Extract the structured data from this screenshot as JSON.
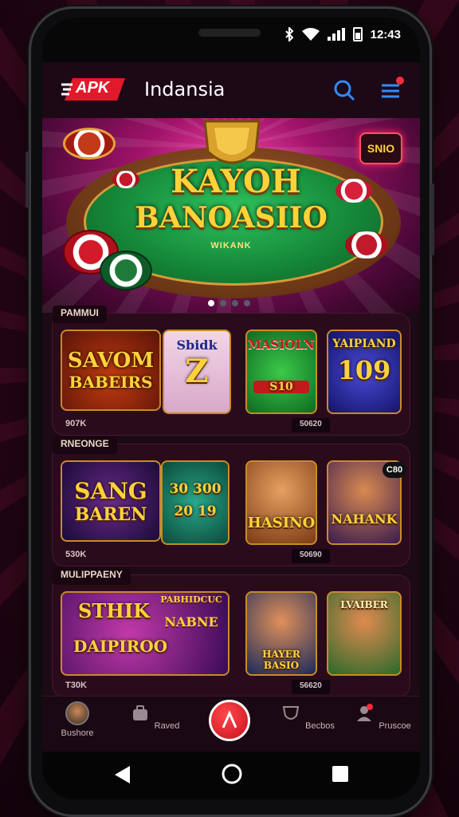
{
  "status": {
    "time": "12:43"
  },
  "app": {
    "logo_text": "APK",
    "title": "Indansia"
  },
  "banner": {
    "title_line1": "KAYOH",
    "title_line2": "BANOASIIO",
    "subtitle": "WIKANK",
    "badge": "SNIO",
    "active_slide": 1,
    "slide_count": 4
  },
  "sections": [
    {
      "label": "PAMMUI",
      "count_left": "907K",
      "count_right": "50620",
      "games": [
        {
          "line1": "SAVOM",
          "line2": "BABEIRS"
        },
        {
          "line1": "Sbidk",
          "line2": "Z"
        },
        {
          "line1": "MASIOLN",
          "line2": "S10"
        },
        {
          "line1": "YAIPIAND",
          "line2": "109"
        }
      ]
    },
    {
      "label": "RNEONGE",
      "count_left": "530K",
      "count_right": "50690",
      "badge": "C80",
      "games": [
        {
          "line1": "SANG",
          "line2": "BAREN"
        },
        {
          "line1": "30 300",
          "line2": "20 19"
        },
        {
          "line1": "HASINO",
          "line2": ""
        },
        {
          "line1": "NAHANK",
          "line2": ""
        }
      ]
    },
    {
      "label": "MULIPPAENY",
      "count_left": "T30K",
      "count_right": "56620",
      "games": [
        {
          "line1": "STHIK",
          "line2": "DAIPIROO"
        },
        {
          "line1": "PABHIDCUC",
          "line2": "NABNE"
        },
        {
          "line1": "HAYER",
          "line2": "BASIO"
        },
        {
          "line1": "LVAIBER",
          "line2": ""
        }
      ]
    }
  ],
  "nav": [
    {
      "label": "Bushore"
    },
    {
      "label": "Raved"
    },
    {
      "label": ""
    },
    {
      "label": "Becbos"
    },
    {
      "label": "Pruscoe"
    }
  ],
  "colors": {
    "accent": "#ff2a3b",
    "gold": "#ffd23a",
    "background": "#1c0a14"
  }
}
